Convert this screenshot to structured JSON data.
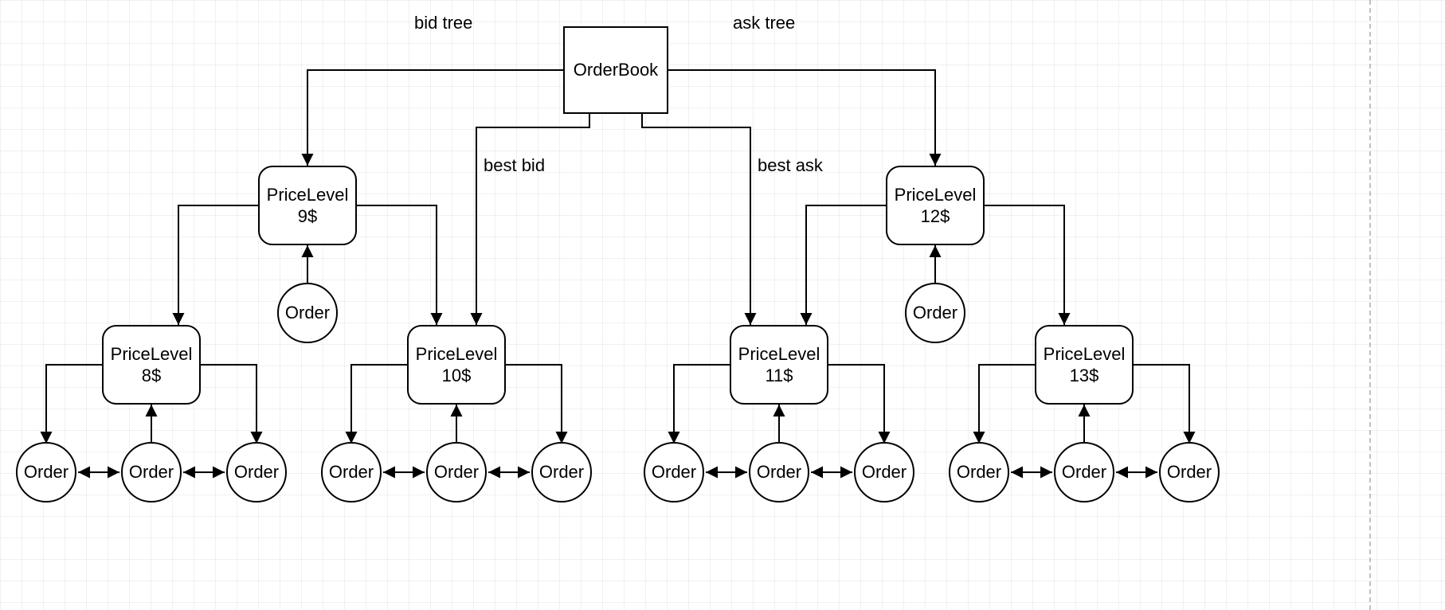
{
  "root": {
    "title": "OrderBook"
  },
  "edgeLabels": {
    "bidTree": "bid tree",
    "askTree": "ask tree",
    "bestBid": "best bid",
    "bestAsk": "best ask"
  },
  "priceLevels": {
    "p9": {
      "name": "PriceLevel",
      "price": "9$"
    },
    "p12": {
      "name": "PriceLevel",
      "price": "12$"
    },
    "p8": {
      "name": "PriceLevel",
      "price": "8$"
    },
    "p10": {
      "name": "PriceLevel",
      "price": "10$"
    },
    "p11": {
      "name": "PriceLevel",
      "price": "11$"
    },
    "p13": {
      "name": "PriceLevel",
      "price": "13$"
    }
  },
  "orderLabel": "Order"
}
